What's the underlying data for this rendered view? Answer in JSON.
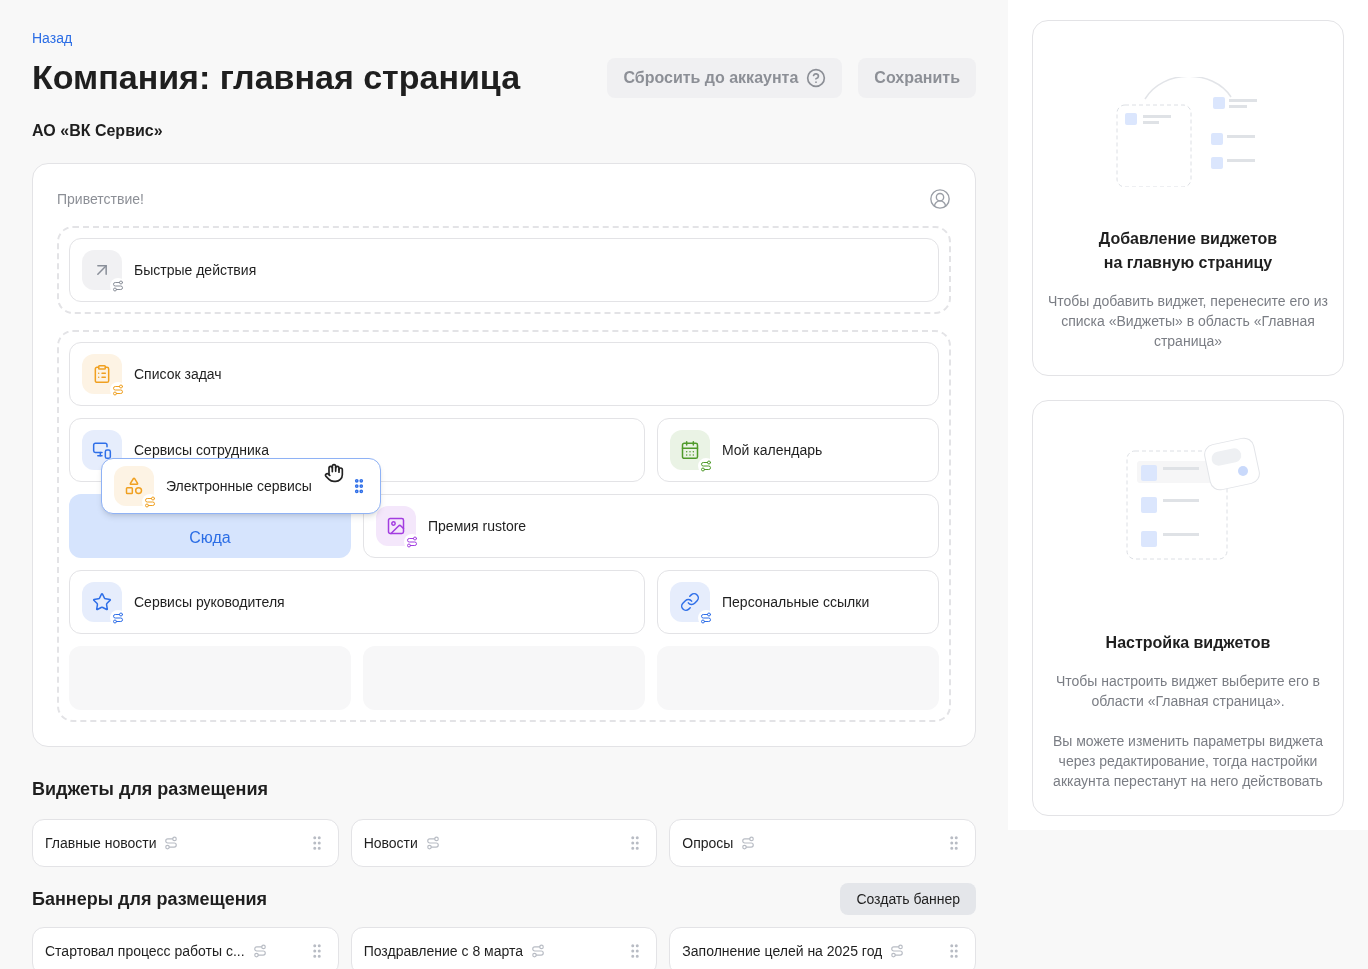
{
  "back_link": "Назад",
  "title": "Компания: главная страница",
  "buttons": [
    {
      "label": "Сбросить до аккаунта",
      "kind": "help"
    },
    {
      "label": "Сохранить",
      "kind": "plain"
    }
  ],
  "company": "АО «ВК Сервис»",
  "canvas": {
    "greeting": "Приветствие!",
    "zones": [
      [
        [
          {
            "kind": "widget",
            "label": "Быстрые действия",
            "color": "#8a8f99"
          }
        ]
      ],
      [
        [
          {
            "kind": "widget",
            "label": "Список задач",
            "color": "#f0a020"
          }
        ],
        [
          {
            "kind": "widget",
            "label": "Сервисы сотрудника",
            "color": "#2f6fe8"
          },
          {
            "kind": "widget",
            "label": "Мой календарь",
            "color": "#4f9a2a"
          }
        ],
        [
          {
            "kind": "dropzone",
            "label": "Сюда"
          },
          {
            "kind": "widget",
            "label": "Премия rustore",
            "color": "#a23ce0"
          }
        ],
        [
          {
            "kind": "widget",
            "label": "Сервисы руководителя",
            "color": "#2f6fe8"
          },
          {
            "kind": "widget",
            "label": "Персональные ссылки",
            "color": "#2f6fe8"
          }
        ],
        [
          {
            "kind": "empty"
          },
          {
            "kind": "empty"
          },
          {
            "kind": "empty"
          }
        ]
      ]
    ]
  },
  "dragged": {
    "label": "Электронные сервисы",
    "color": "#f0a020"
  },
  "widgets_section": {
    "title": "Виджеты для размещения",
    "items": [
      "Главные новости",
      "Новости",
      "Опросы"
    ]
  },
  "banners_section": {
    "title": "Баннеры для размещения",
    "button": "Создать баннер",
    "items": [
      "Стартовал процесс работы с...",
      "Поздравление с 8 марта",
      "Заполнение целей на 2025 год"
    ]
  },
  "help_cards": [
    {
      "title": "Добавление виджетов\nна главную страницу",
      "paragraphs": [
        "Чтобы добавить виджет, перенесите его из списка «Виджеты» в область «Главная страница»"
      ]
    },
    {
      "title": "Настройка виджетов",
      "paragraphs": [
        "Чтобы настроить виджет выберите его в области «Главная страница».",
        "Вы можете изменить параметры виджета через редактирование, тогда настройки аккаунта перестанут на него действовать"
      ]
    }
  ]
}
